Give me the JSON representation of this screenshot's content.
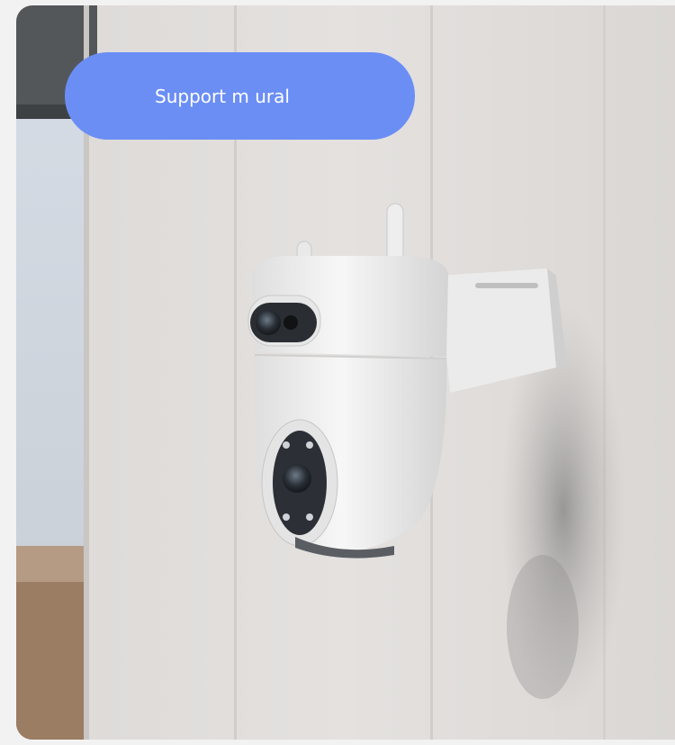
{
  "banner": {
    "label": "Support m ural"
  },
  "photo": {
    "subject": "camera-image"
  },
  "colors": {
    "pill": "#6b8ef5",
    "pill_text": "#ffffff",
    "wall": "#e3e0de",
    "page": "#f2f2f2"
  }
}
